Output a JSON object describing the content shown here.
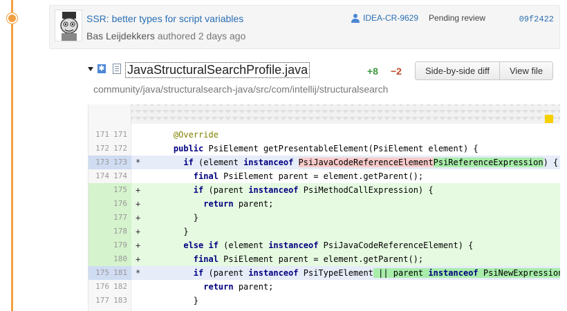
{
  "commit": {
    "title": "SSR: better types for script variables",
    "author": "Bas Leijdekkers",
    "authored": " authored 2 days ago",
    "review_id": "IDEA-CR-9629",
    "review_status": "Pending review",
    "hash": "09f2422"
  },
  "file": {
    "name": "JavaStructuralSearchProfile.java",
    "added": "+8",
    "removed": "−2",
    "path": "community/java/structuralsearch-java/src/com/intellij/structuralsearch",
    "side_by_side_label": "Side-by-side diff",
    "view_file_label": "View file"
  },
  "diff_lines": [
    {
      "old": "171",
      "new": "171",
      "mark": "",
      "type": "ctx",
      "tokens": [
        [
          "    ",
          ""
        ],
        [
          "@Override",
          "ann"
        ]
      ]
    },
    {
      "old": "172",
      "new": "172",
      "mark": "",
      "type": "ctx",
      "tokens": [
        [
          "    ",
          ""
        ],
        [
          "public",
          "kw"
        ],
        [
          " PsiElement getPresentableElement(PsiElement element) {",
          ""
        ]
      ]
    },
    {
      "old": "173",
      "new": "173",
      "mark": "*",
      "type": "changed",
      "tokens": [
        [
          "      ",
          ""
        ],
        [
          "if",
          "kw"
        ],
        [
          " (element ",
          ""
        ],
        [
          "instanceof",
          "kw"
        ],
        [
          " ",
          ""
        ],
        [
          "PsiJavaCodeReferenceElement",
          "rm"
        ],
        [
          "PsiReferenceExpression",
          "ad"
        ],
        [
          ") {",
          ""
        ]
      ]
    },
    {
      "old": "174",
      "new": "174",
      "mark": "",
      "type": "ctx",
      "tokens": [
        [
          "        ",
          ""
        ],
        [
          "final",
          "kw"
        ],
        [
          " PsiElement parent = element.getParent();",
          ""
        ]
      ]
    },
    {
      "old": "",
      "new": "175",
      "mark": "+",
      "type": "added",
      "tokens": [
        [
          "        ",
          ""
        ],
        [
          "if",
          "kw"
        ],
        [
          " (parent ",
          ""
        ],
        [
          "instanceof",
          "kw"
        ],
        [
          " PsiMethodCallExpression) {",
          ""
        ]
      ]
    },
    {
      "old": "",
      "new": "176",
      "mark": "+",
      "type": "added",
      "tokens": [
        [
          "          ",
          ""
        ],
        [
          "return",
          "kw"
        ],
        [
          " parent;",
          ""
        ]
      ]
    },
    {
      "old": "",
      "new": "177",
      "mark": "+",
      "type": "added",
      "tokens": [
        [
          "        }",
          ""
        ]
      ]
    },
    {
      "old": "",
      "new": "178",
      "mark": "+",
      "type": "added",
      "tokens": [
        [
          "      }",
          ""
        ]
      ]
    },
    {
      "old": "",
      "new": "179",
      "mark": "+",
      "type": "added",
      "tokens": [
        [
          "      ",
          ""
        ],
        [
          "else if",
          "kw"
        ],
        [
          " (element ",
          ""
        ],
        [
          "instanceof",
          "kw"
        ],
        [
          " PsiJavaCodeReferenceElement) {",
          ""
        ]
      ]
    },
    {
      "old": "",
      "new": "180",
      "mark": "+",
      "type": "added",
      "tokens": [
        [
          "        ",
          ""
        ],
        [
          "final",
          "kw"
        ],
        [
          " PsiElement parent = element.getParent();",
          ""
        ]
      ]
    },
    {
      "old": "175",
      "new": "181",
      "mark": "*",
      "type": "changed",
      "tokens": [
        [
          "        ",
          ""
        ],
        [
          "if",
          "kw"
        ],
        [
          " (parent ",
          ""
        ],
        [
          "instanceof",
          "kw"
        ],
        [
          " PsiTypeElement",
          ""
        ],
        [
          " || parent ",
          "ad"
        ],
        [
          "instanceof",
          "ad kw"
        ],
        [
          " PsiNewExpression || pa",
          "ad"
        ]
      ]
    },
    {
      "old": "176",
      "new": "182",
      "mark": "",
      "type": "ctx",
      "tokens": [
        [
          "          ",
          ""
        ],
        [
          "return",
          "kw"
        ],
        [
          " parent;",
          ""
        ]
      ]
    },
    {
      "old": "177",
      "new": "183",
      "mark": "",
      "type": "ctx",
      "tokens": [
        [
          "        }",
          ""
        ]
      ]
    }
  ]
}
